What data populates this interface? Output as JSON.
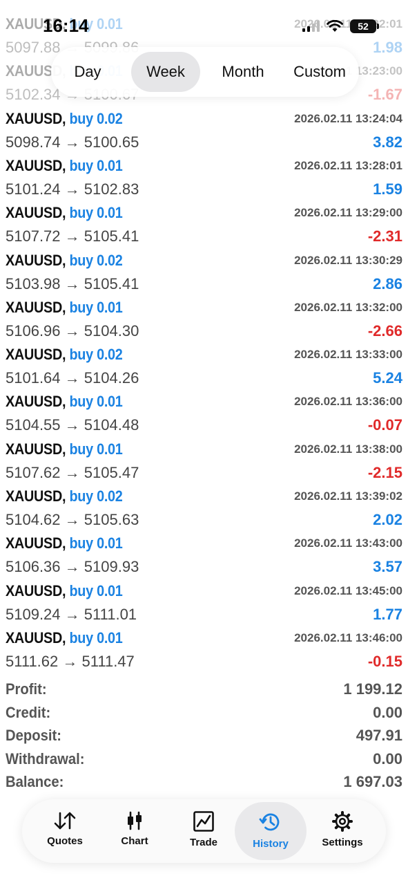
{
  "status_bar": {
    "time": "16:14",
    "battery": "52"
  },
  "period_tabs": [
    "Day",
    "Week",
    "Month",
    "Custom"
  ],
  "active_period": "Week",
  "trades": [
    {
      "symbol": "XAUUSD,",
      "side": "buy 0.01",
      "time": "2026.02.11 13:22:01",
      "open": "5097.88",
      "close": "5099.86",
      "pl": "1.98",
      "dir": "pos"
    },
    {
      "symbol": "XAUUSD,",
      "side": "buy 0.01",
      "time": "2026.02.11 13:23:00",
      "open": "5102.34",
      "close": "5100.67",
      "pl": "-1.67",
      "dir": "neg"
    },
    {
      "symbol": "XAUUSD,",
      "side": "buy 0.02",
      "time": "2026.02.11 13:24:04",
      "open": "5098.74",
      "close": "5100.65",
      "pl": "3.82",
      "dir": "pos"
    },
    {
      "symbol": "XAUUSD,",
      "side": "buy 0.01",
      "time": "2026.02.11 13:28:01",
      "open": "5101.24",
      "close": "5102.83",
      "pl": "1.59",
      "dir": "pos"
    },
    {
      "symbol": "XAUUSD,",
      "side": "buy 0.01",
      "time": "2026.02.11 13:29:00",
      "open": "5107.72",
      "close": "5105.41",
      "pl": "-2.31",
      "dir": "neg"
    },
    {
      "symbol": "XAUUSD,",
      "side": "buy 0.02",
      "time": "2026.02.11 13:30:29",
      "open": "5103.98",
      "close": "5105.41",
      "pl": "2.86",
      "dir": "pos"
    },
    {
      "symbol": "XAUUSD,",
      "side": "buy 0.01",
      "time": "2026.02.11 13:32:00",
      "open": "5106.96",
      "close": "5104.30",
      "pl": "-2.66",
      "dir": "neg"
    },
    {
      "symbol": "XAUUSD,",
      "side": "buy 0.02",
      "time": "2026.02.11 13:33:00",
      "open": "5101.64",
      "close": "5104.26",
      "pl": "5.24",
      "dir": "pos"
    },
    {
      "symbol": "XAUUSD,",
      "side": "buy 0.01",
      "time": "2026.02.11 13:36:00",
      "open": "5104.55",
      "close": "5104.48",
      "pl": "-0.07",
      "dir": "neg"
    },
    {
      "symbol": "XAUUSD,",
      "side": "buy 0.01",
      "time": "2026.02.11 13:38:00",
      "open": "5107.62",
      "close": "5105.47",
      "pl": "-2.15",
      "dir": "neg"
    },
    {
      "symbol": "XAUUSD,",
      "side": "buy 0.02",
      "time": "2026.02.11 13:39:02",
      "open": "5104.62",
      "close": "5105.63",
      "pl": "2.02",
      "dir": "pos"
    },
    {
      "symbol": "XAUUSD,",
      "side": "buy 0.01",
      "time": "2026.02.11 13:43:00",
      "open": "5106.36",
      "close": "5109.93",
      "pl": "3.57",
      "dir": "pos"
    },
    {
      "symbol": "XAUUSD,",
      "side": "buy 0.01",
      "time": "2026.02.11 13:45:00",
      "open": "5109.24",
      "close": "5111.01",
      "pl": "1.77",
      "dir": "pos"
    },
    {
      "symbol": "XAUUSD,",
      "side": "buy 0.01",
      "time": "2026.02.11 13:46:00",
      "open": "5111.62",
      "close": "5111.47",
      "pl": "-0.15",
      "dir": "neg"
    }
  ],
  "arrow": "→",
  "summary": [
    {
      "label": "Profit:",
      "value": "1 199.12"
    },
    {
      "label": "Credit:",
      "value": "0.00"
    },
    {
      "label": "Deposit:",
      "value": "497.91"
    },
    {
      "label": "Withdrawal:",
      "value": "0.00"
    },
    {
      "label": "Balance:",
      "value": "1 697.03"
    }
  ],
  "tabbar": [
    {
      "label": "Quotes",
      "icon": "sort-arrows-icon"
    },
    {
      "label": "Chart",
      "icon": "candlestick-icon"
    },
    {
      "label": "Trade",
      "icon": "trade-chart-icon"
    },
    {
      "label": "History",
      "icon": "history-clock-icon"
    },
    {
      "label": "Settings",
      "icon": "gear-icon"
    }
  ],
  "active_tab": "History",
  "colors": {
    "accent": "#1a82e2",
    "loss": "#e02a2a",
    "label_grey": "#555555"
  }
}
